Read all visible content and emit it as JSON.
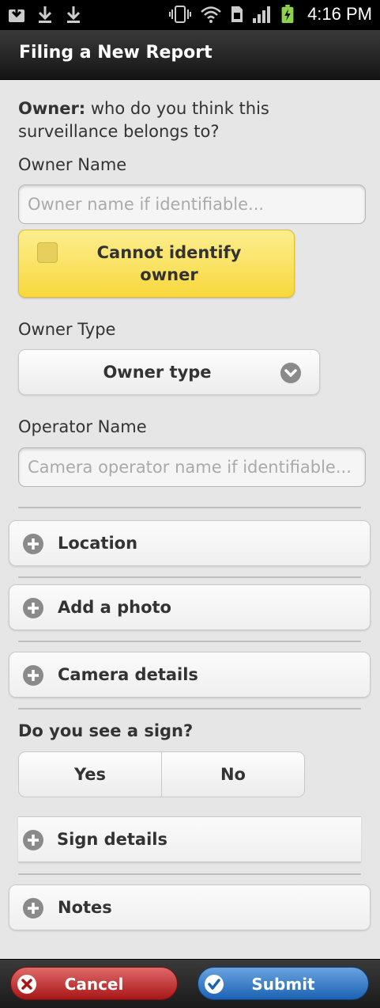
{
  "status_bar": {
    "time": "4:16 PM",
    "left_icons": [
      "download-tray-icon",
      "download-icon",
      "download-icon"
    ],
    "right_icons": [
      "vibrate-icon",
      "wifi-icon",
      "sim-icon",
      "signal-icon",
      "battery-charging-icon"
    ]
  },
  "title_bar": {
    "title": "Filing a New Report"
  },
  "owner_section": {
    "heading_bold": "Owner:",
    "heading_text": " who do you think this surveillance belongs to?",
    "owner_name_label": "Owner Name",
    "owner_name_placeholder": "Owner name if identifiable...",
    "owner_name_value": "",
    "cannot_identify_label": "Cannot identify owner",
    "cannot_identify_checked": false,
    "owner_type_label": "Owner Type",
    "owner_type_select": "Owner type",
    "operator_name_label": "Operator Name",
    "operator_name_placeholder": "Camera operator name if identifiable...",
    "operator_name_value": ""
  },
  "sections": {
    "location": "Location",
    "add_photo": "Add a photo",
    "camera_details": "Camera details"
  },
  "sign_question": {
    "label": "Do you see a sign?",
    "yes": "Yes",
    "no": "No"
  },
  "sign_details": "Sign details",
  "notes": "Notes",
  "footer": {
    "cancel": "Cancel",
    "submit": "Submit"
  },
  "colors": {
    "yellow_button": "#f8d83d",
    "cancel_red": "#a81616",
    "submit_blue": "#1b62b3",
    "background": "#e6e6e6"
  }
}
